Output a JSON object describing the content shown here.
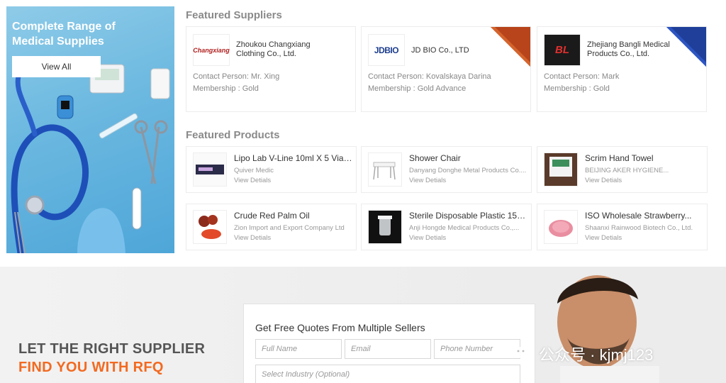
{
  "promo": {
    "title": "Complete Range of Medical Supplies",
    "button_label": "View All"
  },
  "featured_suppliers": {
    "title": "Featured Suppliers",
    "items": [
      {
        "logo_text": "Changxiang",
        "name": "Zhoukou Changxiang Clothing Co., Ltd.",
        "contact": "Contact Person: Mr. Xing",
        "membership": "Membership : Gold",
        "ribbon_color": "#1f3f9a"
      },
      {
        "logo_text": "JDBIO",
        "name": "JD BIO Co., LTD",
        "contact": "Contact Person: Kovalskaya Darina",
        "membership": "Membership : Gold Advance",
        "ribbon_color": "#b8441b"
      },
      {
        "logo_text": "BL",
        "name": "Zhejiang Bangli Medical Products Co., Ltd.",
        "contact": "Contact Person: Mark",
        "membership": "Membership : Gold",
        "ribbon_color": "#1f3f9a"
      }
    ]
  },
  "featured_products": {
    "title": "Featured Products",
    "view_label": "View Detials",
    "items": [
      {
        "name": "Lipo Lab V-Line 10ml X 5 Vials...",
        "company": "Quiver Medic"
      },
      {
        "name": "Shower Chair",
        "company": "Danyang Donghe Metal Products Co...."
      },
      {
        "name": "Scrim Hand Towel",
        "company": "BEIJING AKER HYGIENE..."
      },
      {
        "name": "Crude Red Palm Oil",
        "company": "Zion Import and Export Company Ltd"
      },
      {
        "name": "Sterile Disposable Plastic 150...",
        "company": "Anji Hongde Medical Products Co.,..."
      },
      {
        "name": "ISO Wholesale Strawberry...",
        "company": "Shaanxi Rainwood Biotech Co., Ltd."
      }
    ]
  },
  "rfq": {
    "headline": "LET THE RIGHT SUPPLIER",
    "subheadline": "FIND YOU WITH RFQ",
    "form_title": "Get Free Quotes From Multiple Sellers",
    "full_name_placeholder": "Full Name",
    "email_placeholder": "Email",
    "phone_placeholder": "Phone Number",
    "industry_placeholder": "Select Industry (Optional)"
  },
  "watermark": {
    "text": "公众号 · kjmj123"
  },
  "colors": {
    "accent_orange": "#f26a21",
    "ribbon_blue": "#1f3f9a",
    "ribbon_brown": "#b8441b"
  }
}
